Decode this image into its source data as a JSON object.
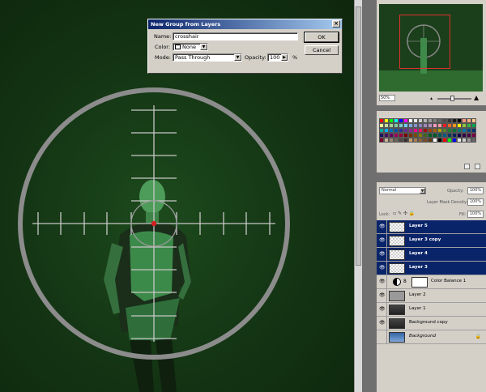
{
  "dialog": {
    "title": "New Group from Layers",
    "name_label": "Name:",
    "name_value": "crosshair",
    "color_label": "Color:",
    "color_value": "None",
    "mode_label": "Mode:",
    "mode_value": "Pass Through",
    "opacity_label": "Opacity:",
    "opacity_value": "100",
    "opacity_unit": "%",
    "ok_label": "OK",
    "cancel_label": "Cancel",
    "close_glyph": "×"
  },
  "navigator": {
    "zoom": "50%"
  },
  "layers_panel": {
    "blend_mode": "Normal",
    "opacity_label": "Opacity:",
    "opacity_value": "100%",
    "mask_density_label": "Layer Mask Density:",
    "mask_density_value": "100%",
    "lock_label": "Lock:",
    "fill_label": "Fill:",
    "fill_value": "100%",
    "layers": [
      {
        "name": "Layer 5",
        "selected": true,
        "thumb": "checker"
      },
      {
        "name": "Layer 3 copy",
        "selected": true,
        "thumb": "checker"
      },
      {
        "name": "Layer 4",
        "selected": true,
        "thumb": "checker"
      },
      {
        "name": "Layer 3",
        "selected": true,
        "thumb": "checker"
      },
      {
        "name": "Color Balance 1",
        "selected": false,
        "thumb": "adjustment"
      },
      {
        "name": "Layer 2",
        "selected": false,
        "thumb": "gray"
      },
      {
        "name": "Layer 1",
        "selected": false,
        "thumb": "photo"
      },
      {
        "name": "Background copy",
        "selected": false,
        "thumb": "photo"
      },
      {
        "name": "Background",
        "selected": false,
        "thumb": "bg",
        "locked": true
      }
    ]
  },
  "colors": {
    "canvas_green": "#163a16",
    "reticle_gray": "#8c8c8c",
    "crosshair_line": "#c8c8c8",
    "center_dot": "#d42020",
    "selection_blue": "#0a246a"
  },
  "icons": [
    "eye-icon",
    "chain-link-icon",
    "lock-icon",
    "adjustment-layer-icon",
    "dropdown-arrow-icon",
    "close-icon"
  ]
}
